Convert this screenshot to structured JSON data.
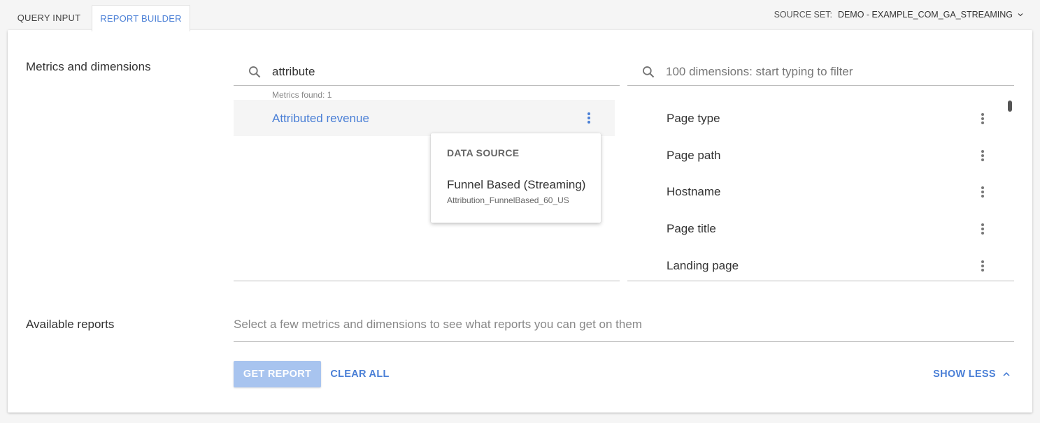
{
  "tabs": [
    {
      "label": "QUERY INPUT",
      "active": false
    },
    {
      "label": "REPORT BUILDER",
      "active": true
    }
  ],
  "source_set": {
    "label": "SOURCE SET:",
    "value": "DEMO - EXAMPLE_COM_GA_STREAMING",
    "icon": "chevron-down-icon"
  },
  "metrics_section": {
    "label": "Metrics and dimensions",
    "search_value": "attribute",
    "found_text": "Metrics found: 1",
    "results": [
      {
        "name": "Attributed revenue"
      }
    ]
  },
  "dimensions": {
    "placeholder": "100 dimensions: start typing to filter",
    "items": [
      {
        "name": "Page type"
      },
      {
        "name": "Page path"
      },
      {
        "name": "Hostname"
      },
      {
        "name": "Page title"
      },
      {
        "name": "Landing page"
      }
    ]
  },
  "popup": {
    "title": "DATA SOURCE",
    "source_name": "Funnel Based (Streaming)",
    "source_id": "Attribution_FunnelBased_60_US"
  },
  "reports_section": {
    "label": "Available reports",
    "hint": "Select a few metrics and dimensions to see what reports you can get on them"
  },
  "buttons": {
    "get_report": "GET REPORT",
    "clear_all": "CLEAR ALL",
    "show_less": "SHOW LESS"
  },
  "colors": {
    "accent": "#4a7fd6",
    "disabled_button": "#a8c4ef"
  }
}
